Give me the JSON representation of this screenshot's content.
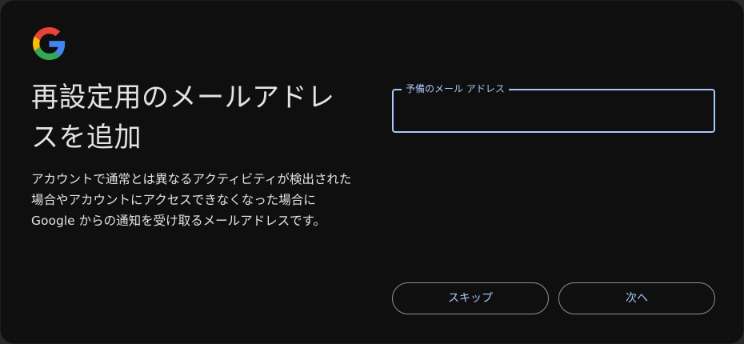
{
  "dialog": {
    "logo_icon": "google-g-icon",
    "title": "再設定用のメールアドレスを追加",
    "description": "アカウントで通常とは異なるアクティビティが検出された場合やアカウントにアクセスできなくなった場合に Google からの通知を受け取るメールアドレスです。",
    "email_field": {
      "label": "予備のメール アドレス",
      "value": ""
    },
    "buttons": {
      "skip": "スキップ",
      "next": "次へ"
    }
  },
  "colors": {
    "background": "#0f0f0f",
    "text": "#e3e3e3",
    "accent": "#a8c7fa",
    "button_border": "#8e918f"
  }
}
